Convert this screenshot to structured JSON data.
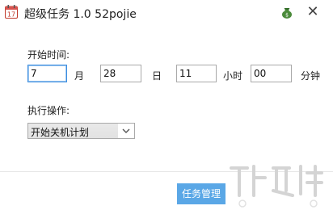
{
  "window": {
    "title": "超级任务 1.0 52pojie",
    "close_glyph": "✕",
    "app_icon": "calendar-icon",
    "app_icon_text": "17",
    "extra_icon": "money-bag-icon"
  },
  "start_time": {
    "label": "开始时间:",
    "month": {
      "value": "7",
      "unit": "月"
    },
    "day": {
      "value": "28",
      "unit": "日"
    },
    "hour": {
      "value": "11",
      "unit": "小时"
    },
    "minute": {
      "value": "00",
      "unit": "分钟"
    }
  },
  "action": {
    "label": "执行操作:",
    "selected": "开始关机计划"
  },
  "footer": {
    "task_button_label": "任务管理"
  },
  "colors": {
    "accent": "#5aa7e6",
    "focus_border": "#3c8de0"
  }
}
